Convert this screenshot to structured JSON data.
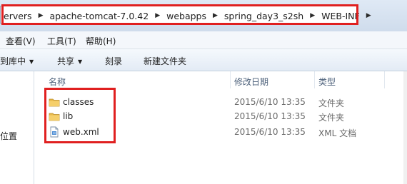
{
  "breadcrumbs": [
    "ervers",
    "apache-tomcat-7.0.42",
    "webapps",
    "spring_day3_s2sh",
    "WEB-INF"
  ],
  "menu": [
    "查看(V)",
    "工具(T)",
    "帮助(H)"
  ],
  "toolbar": {
    "include_in_library": "到库中",
    "share": "共享",
    "burn": "刻录",
    "new_folder": "新建文件夹"
  },
  "nav": {
    "location": "位置"
  },
  "columns": {
    "name": "名称",
    "date": "修改日期",
    "type": "类型"
  },
  "files": [
    {
      "name": "classes",
      "date": "2015/6/10 13:35",
      "type": "文件夹",
      "icon": "folder-icon"
    },
    {
      "name": "lib",
      "date": "2015/6/10 13:35",
      "type": "文件夹",
      "icon": "folder-icon"
    },
    {
      "name": "web.xml",
      "date": "2015/6/10 13:35",
      "type": "XML 文档",
      "icon": "xml-file-icon"
    }
  ],
  "colors": {
    "highlight": "#e02020",
    "folder": "#e8b84a"
  }
}
